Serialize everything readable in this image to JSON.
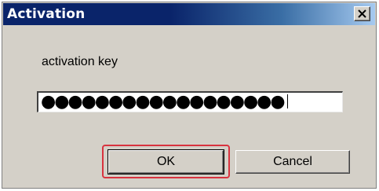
{
  "window": {
    "title": "Activation"
  },
  "form": {
    "field_label": "activation key",
    "masked_value": "●●●●●●●●●●●●●●●●●●"
  },
  "buttons": {
    "ok_label": "OK",
    "cancel_label": "Cancel"
  },
  "icons": {
    "close": "close-icon"
  },
  "colors": {
    "titlebar": "#0a246a",
    "dialog_bg": "#d4d0c8",
    "highlight": "#d9333f"
  }
}
